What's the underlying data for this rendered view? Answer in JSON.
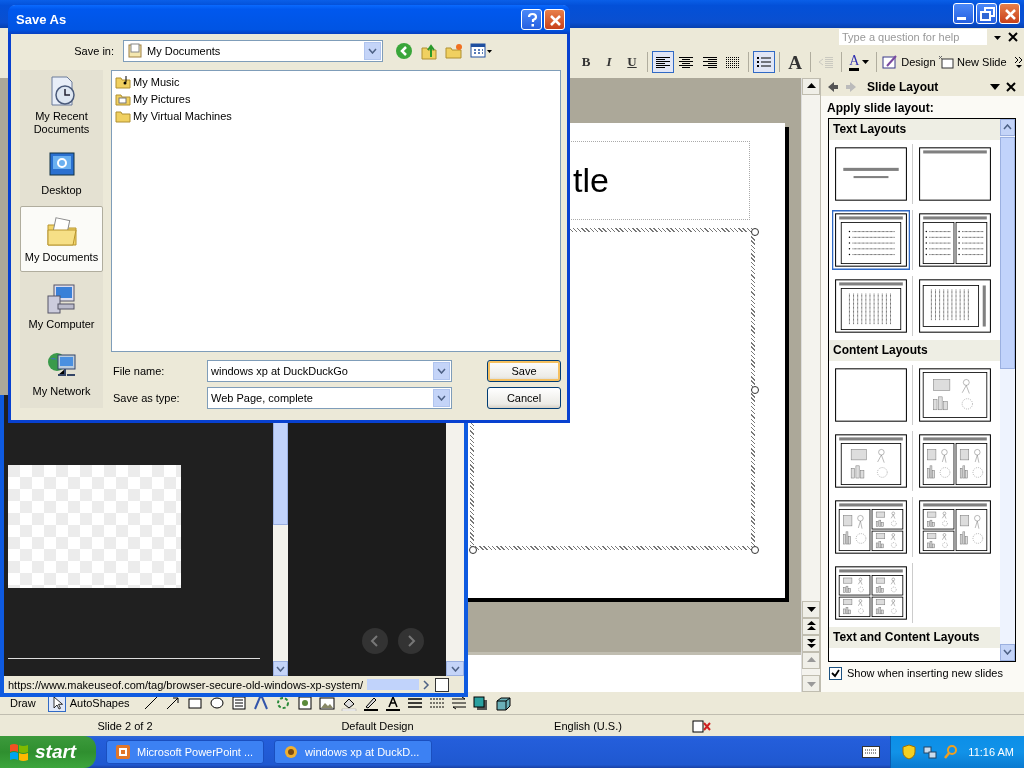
{
  "powerpoint": {
    "help_placeholder": "Type a question for help",
    "toolbar": [
      {
        "kind": "bold",
        "label": "B",
        "selected": false,
        "disabled": false
      },
      {
        "kind": "italic",
        "label": "I",
        "selected": false,
        "disabled": false
      },
      {
        "kind": "underline",
        "label": "U",
        "selected": false,
        "disabled": false
      },
      {
        "kind": "align-left",
        "selected": true,
        "disabled": false
      },
      {
        "kind": "align-center",
        "selected": false,
        "disabled": false
      },
      {
        "kind": "align-right",
        "selected": false,
        "disabled": false
      },
      {
        "kind": "distribute",
        "selected": false,
        "disabled": false
      },
      {
        "kind": "bullets",
        "selected": true,
        "disabled": false
      },
      {
        "kind": "grow-font",
        "label": "A",
        "selected": false,
        "disabled": false
      },
      {
        "kind": "decrease-indent",
        "selected": false,
        "disabled": true
      },
      {
        "kind": "font-color",
        "label": "A",
        "selected": false,
        "disabled": false
      },
      {
        "kind": "design",
        "label": "Design",
        "selected": false,
        "disabled": false
      },
      {
        "kind": "new-slide",
        "label": "New Slide",
        "selected": false,
        "disabled": false
      }
    ],
    "slide_title": "tle",
    "task_pane": {
      "title": "Slide Layout",
      "heading": "Apply slide layout:",
      "sections": [
        {
          "title": "Text Layouts",
          "layouts": [
            {
              "kind": "title-slide",
              "selected": false
            },
            {
              "kind": "title-only",
              "selected": false
            },
            {
              "kind": "title-text",
              "selected": true
            },
            {
              "kind": "two-column-text",
              "selected": false
            },
            {
              "kind": "vertical-text",
              "selected": false
            },
            {
              "kind": "vertical-title-text",
              "selected": false
            }
          ]
        },
        {
          "title": "Content Layouts",
          "layouts": [
            {
              "kind": "blank",
              "selected": false
            },
            {
              "kind": "content",
              "selected": false
            },
            {
              "kind": "title-content",
              "selected": false
            },
            {
              "kind": "two-content",
              "selected": false
            },
            {
              "kind": "content-and-two",
              "selected": false
            },
            {
              "kind": "two-and-content",
              "selected": false
            },
            {
              "kind": "four-content",
              "selected": false
            }
          ]
        },
        {
          "title": "Text and Content Layouts"
        }
      ],
      "show_option": {
        "label": "Show when inserting new slides",
        "checked": true
      }
    },
    "drawing_toolbar": {
      "draw": "Draw",
      "autoshapes": "AutoShapes"
    },
    "status_bar": [
      "Slide 2 of 2",
      "Default Design",
      "English (U.S.)"
    ]
  },
  "browser": {
    "status_url": "https://www.makeuseof.com/tag/browser-secure-old-windows-xp-system/"
  },
  "dialog": {
    "title": "Save As",
    "save_in_label": "Save in:",
    "save_in": "My Documents",
    "places": [
      {
        "kind": "recent",
        "label": "My Recent Documents",
        "selected": false
      },
      {
        "kind": "desktop",
        "label": "Desktop",
        "selected": false
      },
      {
        "kind": "documents",
        "label": "My Documents",
        "selected": true
      },
      {
        "kind": "computer",
        "label": "My Computer",
        "selected": false
      },
      {
        "kind": "network",
        "label": "My Network",
        "selected": false
      }
    ],
    "files": [
      {
        "kind": "music",
        "name": "My Music"
      },
      {
        "kind": "pictures",
        "name": "My Pictures"
      },
      {
        "kind": "folder",
        "name": "My Virtual Machines"
      }
    ],
    "file_name_label": "File name:",
    "file_name": "windows xp at DuckDuckGo",
    "type_label": "Save as type:",
    "type": "Web Page, complete",
    "buttons": [
      {
        "label": "Save",
        "default": true
      },
      {
        "label": "Cancel",
        "default": false
      }
    ]
  },
  "taskbar": {
    "start": "start",
    "tasks": [
      {
        "kind": "powerpoint",
        "label": "Microsoft PowerPoint ...",
        "selected": false
      },
      {
        "kind": "browser",
        "label": "windows xp at DuckD...",
        "selected": false
      }
    ],
    "clock": "11:16 AM"
  }
}
